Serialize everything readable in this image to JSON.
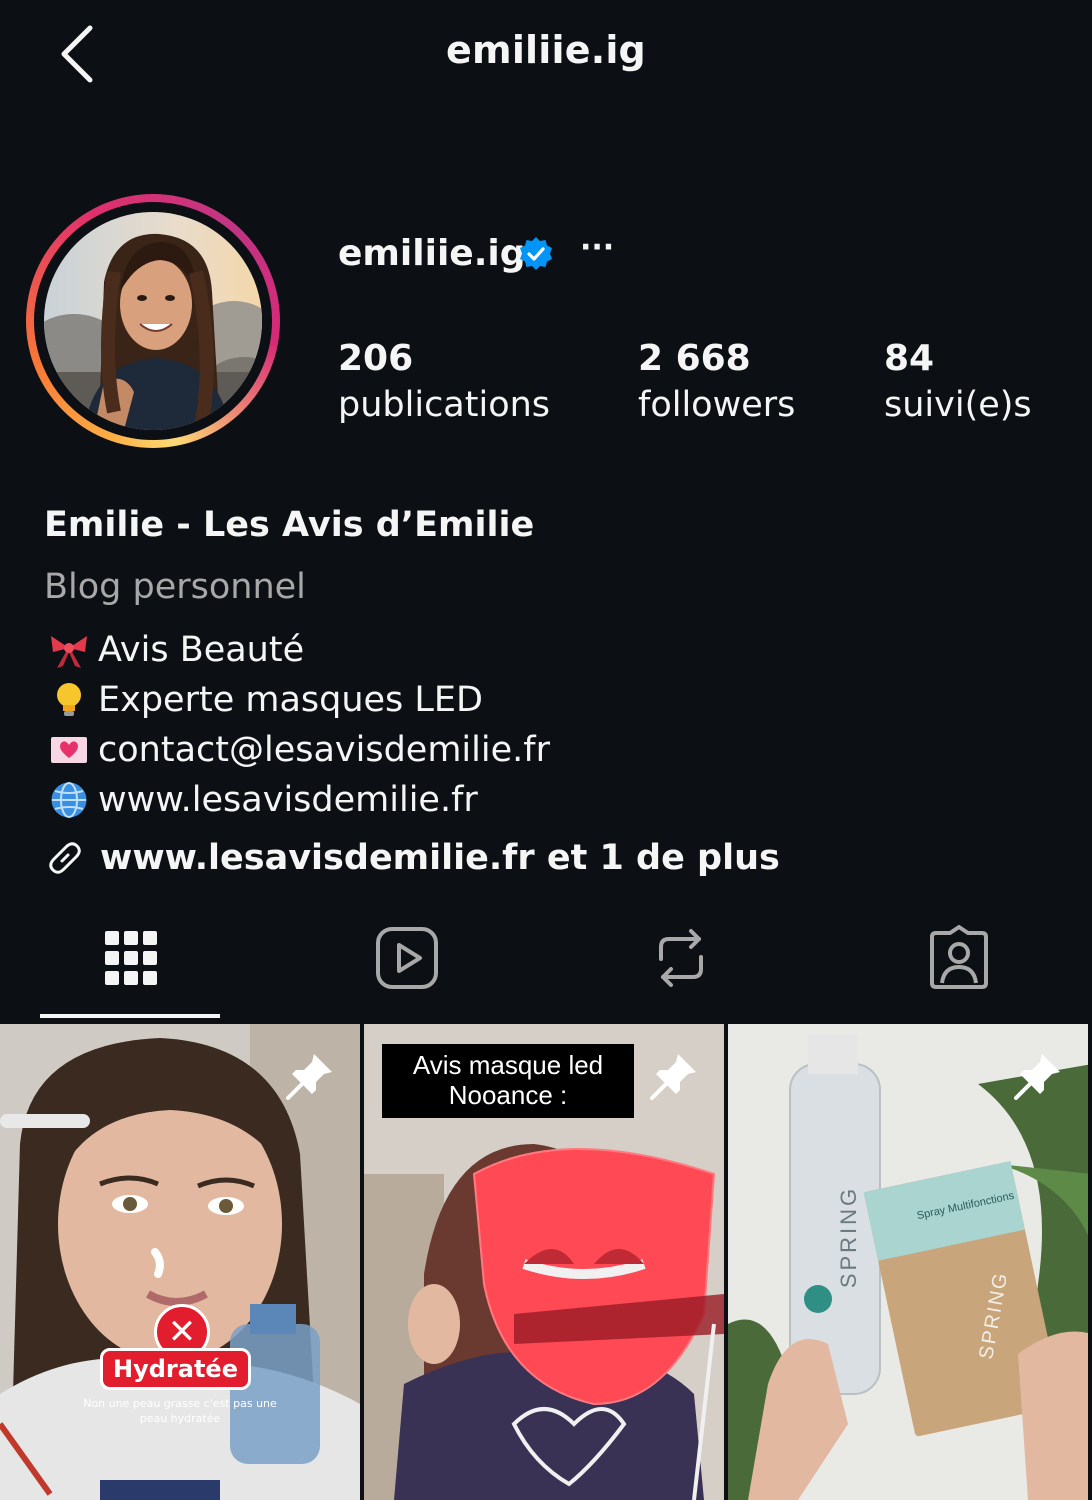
{
  "header": {
    "title": "emiliie.ig",
    "back_icon": "chevron-left-icon"
  },
  "profile": {
    "username": "emiliie.ig",
    "verified": true,
    "more_label": "···",
    "stats": [
      {
        "value": "206",
        "label": "publications"
      },
      {
        "value": "2 668",
        "label": "followers"
      },
      {
        "value": "84",
        "label": "suivi(e)s"
      }
    ]
  },
  "bio": {
    "full_name": "Emilie - Les Avis d’Emilie",
    "category": "Blog personnel",
    "lines": [
      {
        "emoji": "ribbon-icon",
        "text": "Avis Beauté"
      },
      {
        "emoji": "lightbulb-icon",
        "text": "Experte masques LED"
      },
      {
        "emoji": "love-letter-icon",
        "text": "contact@lesavisdemilie.fr"
      },
      {
        "emoji": "globe-icon",
        "text": "www.lesavisdemilie.fr"
      }
    ],
    "link_text": "www.lesavisdemilie.fr et 1 de plus"
  },
  "tabs": [
    {
      "name": "posts",
      "icon": "grid-icon",
      "active": true
    },
    {
      "name": "reels",
      "icon": "reels-icon",
      "active": false
    },
    {
      "name": "reposts",
      "icon": "repost-icon",
      "active": false
    },
    {
      "name": "tagged",
      "icon": "tagged-user-icon",
      "active": false
    }
  ],
  "grid": [
    {
      "pinned": true,
      "sticker_label": "Hydratée",
      "sticker_sub": "Non une peau grasse c'est pas une peau hydratée",
      "sticker_x": "✕"
    },
    {
      "pinned": true,
      "caption_line1": "Avis masque led",
      "caption_line2": "Nooance :"
    },
    {
      "pinned": true,
      "bottle_brand": "SPRING",
      "sachet_brand": "SPRING",
      "sachet_text": "Spray Multifonctions"
    }
  ],
  "colors": {
    "background": "#0c1014",
    "text_primary": "#f5f5f5",
    "text_secondary": "#a8a8a8",
    "verified_blue": "#0095f6"
  }
}
